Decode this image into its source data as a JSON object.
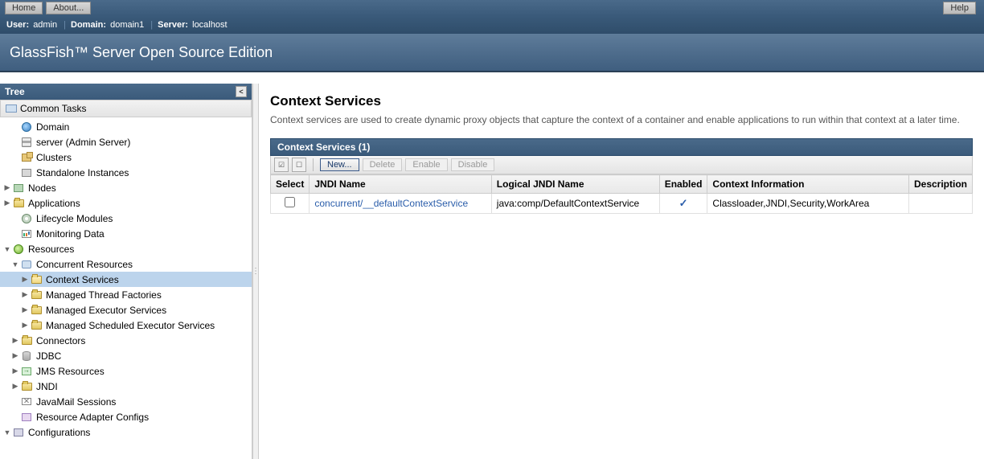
{
  "topbar": {
    "home": "Home",
    "about": "About...",
    "help": "Help"
  },
  "infobar": {
    "user_label": "User:",
    "user": "admin",
    "domain_label": "Domain:",
    "domain": "domain1",
    "server_label": "Server:",
    "server": "localhost"
  },
  "banner": {
    "title": "GlassFish™ Server Open Source Edition"
  },
  "sidebar": {
    "tree_label": "Tree",
    "common_tasks": "Common Tasks",
    "items": {
      "domain": "Domain",
      "admin_server": "server (Admin Server)",
      "clusters": "Clusters",
      "standalone": "Standalone Instances",
      "nodes": "Nodes",
      "applications": "Applications",
      "lifecycle": "Lifecycle Modules",
      "monitoring": "Monitoring Data",
      "resources": "Resources",
      "concurrent": "Concurrent Resources",
      "context_services": "Context Services",
      "mtf": "Managed Thread Factories",
      "mes": "Managed Executor Services",
      "mses": "Managed Scheduled Executor Services",
      "connectors": "Connectors",
      "jdbc": "JDBC",
      "jms": "JMS Resources",
      "jndi": "JNDI",
      "javamail": "JavaMail Sessions",
      "rac": "Resource Adapter Configs",
      "configurations": "Configurations"
    }
  },
  "page": {
    "title": "Context Services",
    "description": "Context services are used to create dynamic proxy objects that capture the context of a container and enable applications to run within that context at a later time.",
    "panel_title": "Context Services (1)",
    "buttons": {
      "new": "New...",
      "delete": "Delete",
      "enable": "Enable",
      "disable": "Disable"
    },
    "columns": {
      "select": "Select",
      "jndi": "JNDI Name",
      "logical": "Logical JNDI Name",
      "enabled": "Enabled",
      "context": "Context Information",
      "description": "Description"
    },
    "rows": [
      {
        "jndi": "concurrent/__defaultContextService",
        "logical": "java:comp/DefaultContextService",
        "enabled": true,
        "context": "Classloader,JNDI,Security,WorkArea",
        "description": ""
      }
    ]
  }
}
